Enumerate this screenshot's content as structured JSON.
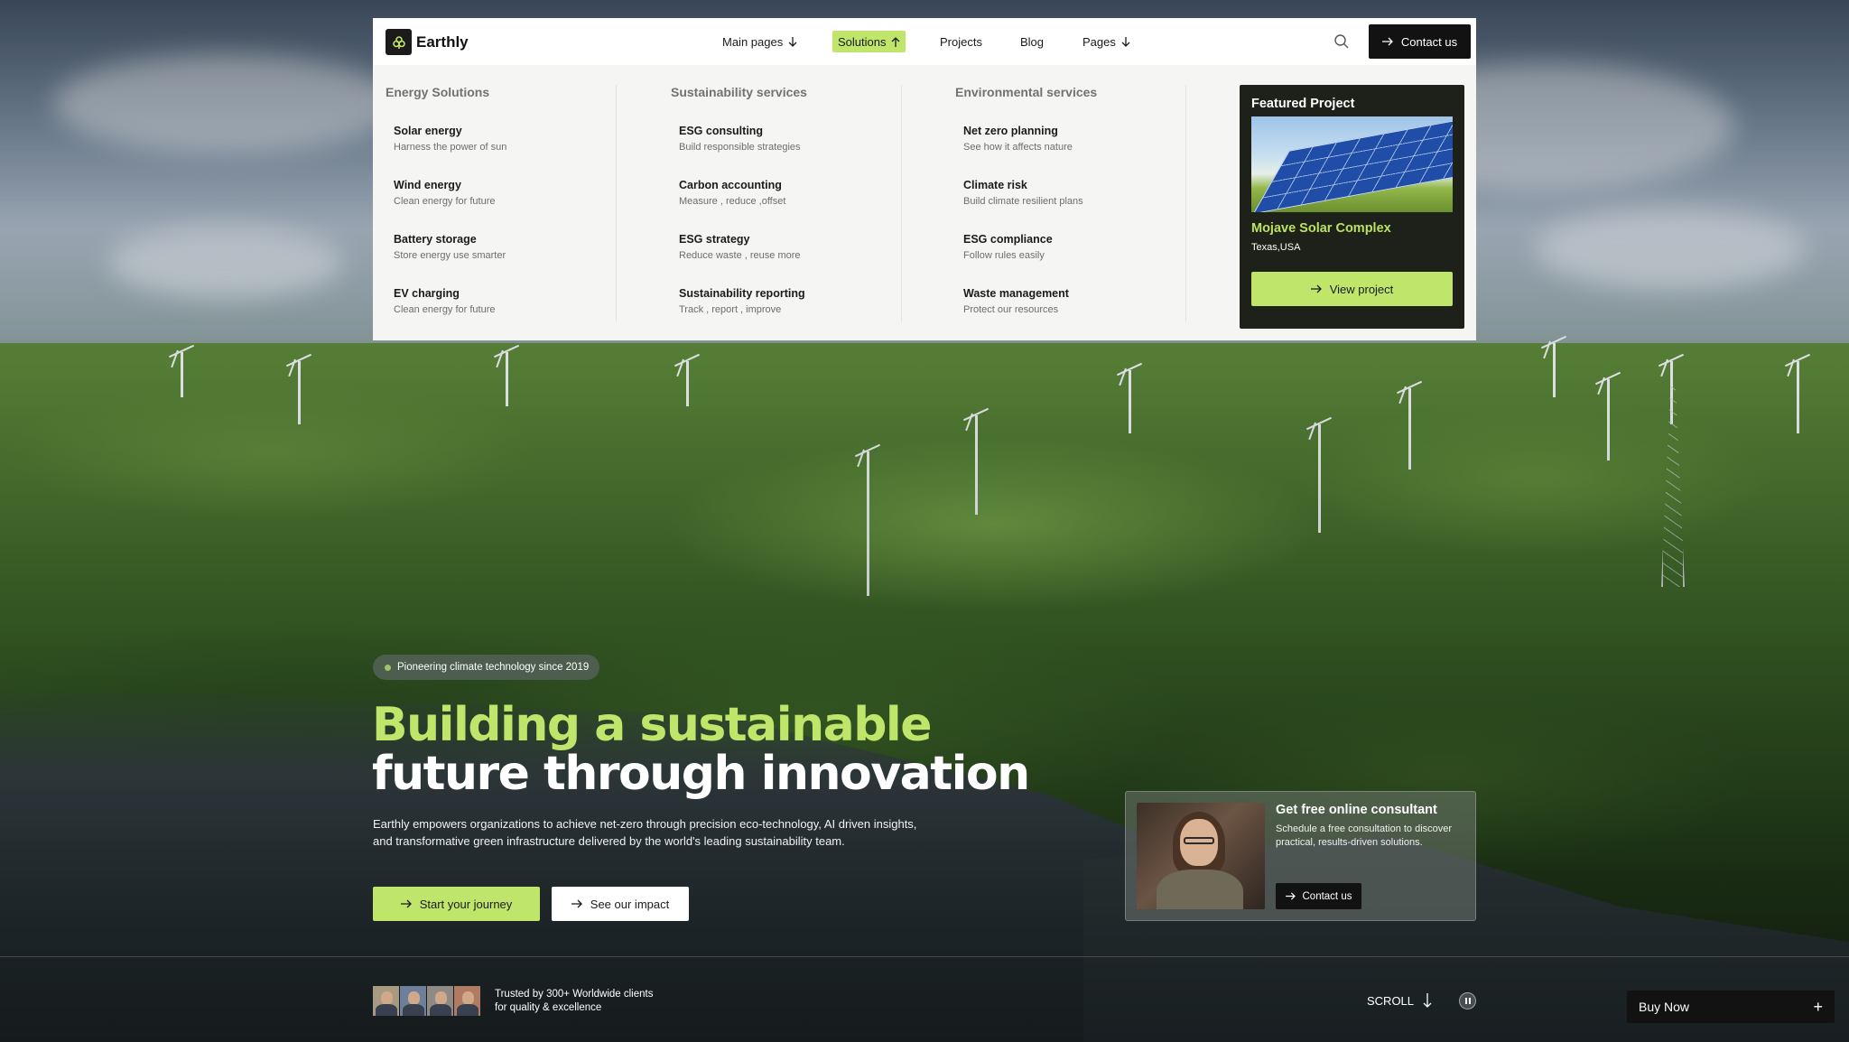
{
  "header": {
    "brand": "Earthly",
    "nav": [
      {
        "label": "Main pages",
        "icon": "arrow-down-icon"
      },
      {
        "label": "Solutions",
        "icon": "arrow-up-icon",
        "active": true
      },
      {
        "label": "Projects"
      },
      {
        "label": "Blog"
      },
      {
        "label": "Pages",
        "icon": "arrow-down-icon"
      }
    ],
    "contact_label": "Contact us",
    "accent_color": "#bfe56b"
  },
  "mega_menu": {
    "columns": [
      {
        "title": "Energy Solutions",
        "items": [
          {
            "title": "Solar energy",
            "subtitle": "Harness the power of sun"
          },
          {
            "title": "Wind energy",
            "subtitle": "Clean energy for future"
          },
          {
            "title": "Battery storage",
            "subtitle": "Store energy use smarter"
          },
          {
            "title": "EV charging",
            "subtitle": "Clean energy for future"
          }
        ]
      },
      {
        "title": "Sustainability services",
        "items": [
          {
            "title": "ESG consulting",
            "subtitle": "Build responsible strategies"
          },
          {
            "title": "Carbon accounting",
            "subtitle": "Measure , reduce ,offset"
          },
          {
            "title": "ESG strategy",
            "subtitle": "Reduce waste , reuse more"
          },
          {
            "title": "Sustainability reporting",
            "subtitle": "Track , report , improve"
          }
        ]
      },
      {
        "title": "Environmental services",
        "items": [
          {
            "title": "Net zero planning",
            "subtitle": "See how it affects nature"
          },
          {
            "title": "Climate risk",
            "subtitle": "Build climate resilient plans"
          },
          {
            "title": "ESG compliance",
            "subtitle": "Follow rules easily"
          },
          {
            "title": "Waste management",
            "subtitle": "Protect our resources"
          }
        ]
      }
    ],
    "featured": {
      "label": "Featured Project",
      "name": "Mojave Solar Complex",
      "location": "Texas,USA",
      "button": "View project"
    }
  },
  "hero": {
    "badge": "Pioneering climate technology since 2019",
    "headline_line1": "Building a sustainable",
    "headline_line2": "future through innovation",
    "description": "Earthly empowers organizations to achieve net-zero through precision eco-technology, AI driven insights, and transformative green infrastructure delivered by the world's leading sustainability team.",
    "primary_button": "Start your journey",
    "secondary_button": "See our impact"
  },
  "consultant_card": {
    "title": "Get free online consultant",
    "text": "Schedule a free consultation to discover practical, results-driven solutions.",
    "button": "Contact us"
  },
  "footer_bar": {
    "trusted_line1": "Trusted by 300+ Worldwide clients",
    "trusted_line2": "for quality & excellence",
    "scroll_label": "SCROLL",
    "buy_now": "Buy Now"
  }
}
